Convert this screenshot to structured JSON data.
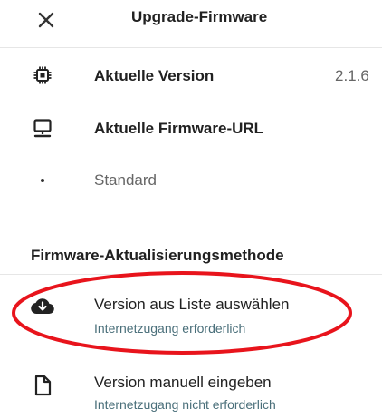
{
  "header": {
    "title": "Upgrade-Firmware",
    "close_icon": "close-icon"
  },
  "info": {
    "current_version": {
      "icon": "chip-icon",
      "label": "Aktuelle Version",
      "value": "2.1.6"
    },
    "firmware_url": {
      "icon": "monitor-icon",
      "label": "Aktuelle Firmware-URL",
      "value": "Standard"
    }
  },
  "method": {
    "header": "Firmware-Aktualisierungsmethode",
    "options": [
      {
        "icon": "cloud-download-icon",
        "title": "Version aus Liste auswählen",
        "subtitle": "Internetzugang erforderlich"
      },
      {
        "icon": "file-icon",
        "title": "Version manuell eingeben",
        "subtitle": "Internetzugang nicht erforderlich"
      }
    ]
  },
  "colors": {
    "annotation": "#e8141c",
    "text_primary": "#212121",
    "text_secondary": "#666666",
    "subtitle": "#4a6f7a",
    "divider": "#e6e6e6"
  }
}
